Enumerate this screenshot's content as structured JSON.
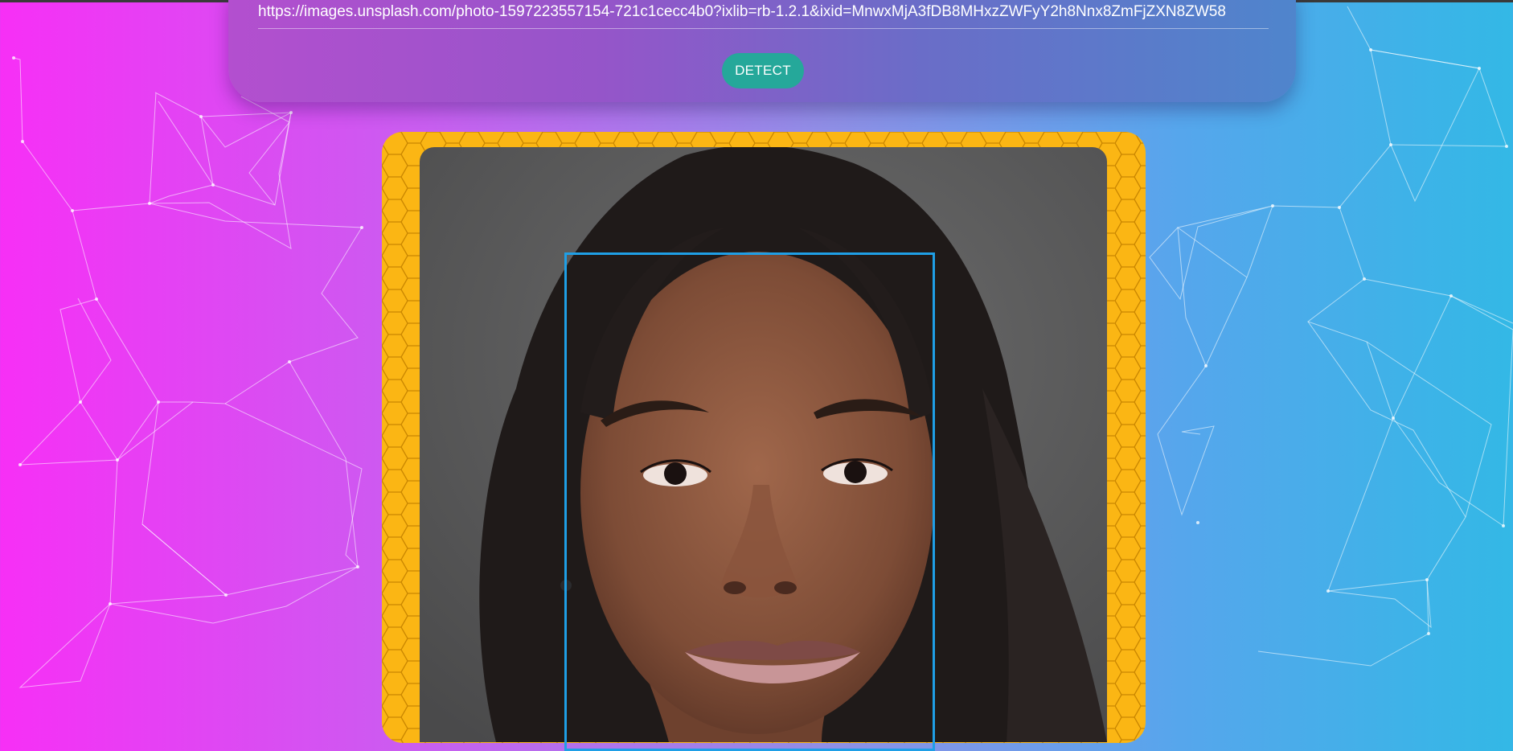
{
  "form": {
    "url_value": "https://images.unsplash.com/photo-1597223557154-721c1cecc4b0?ixlib=rb-1.2.1&ixid=MnwxMjA3fDB8MHxzZWFyY2h8Nnx8ZmFjZXN8ZW58",
    "detect_label": "DETECT"
  },
  "colors": {
    "background_left": "#f72ff6",
    "background_right": "#33b8e6",
    "panel": "#9555c9",
    "detect_button": "#25a89a",
    "frame": "#fbb614",
    "face_box": "#1f9fe6"
  },
  "icons": {
    "background": "particle-network",
    "frame": "honeycomb-pattern"
  }
}
